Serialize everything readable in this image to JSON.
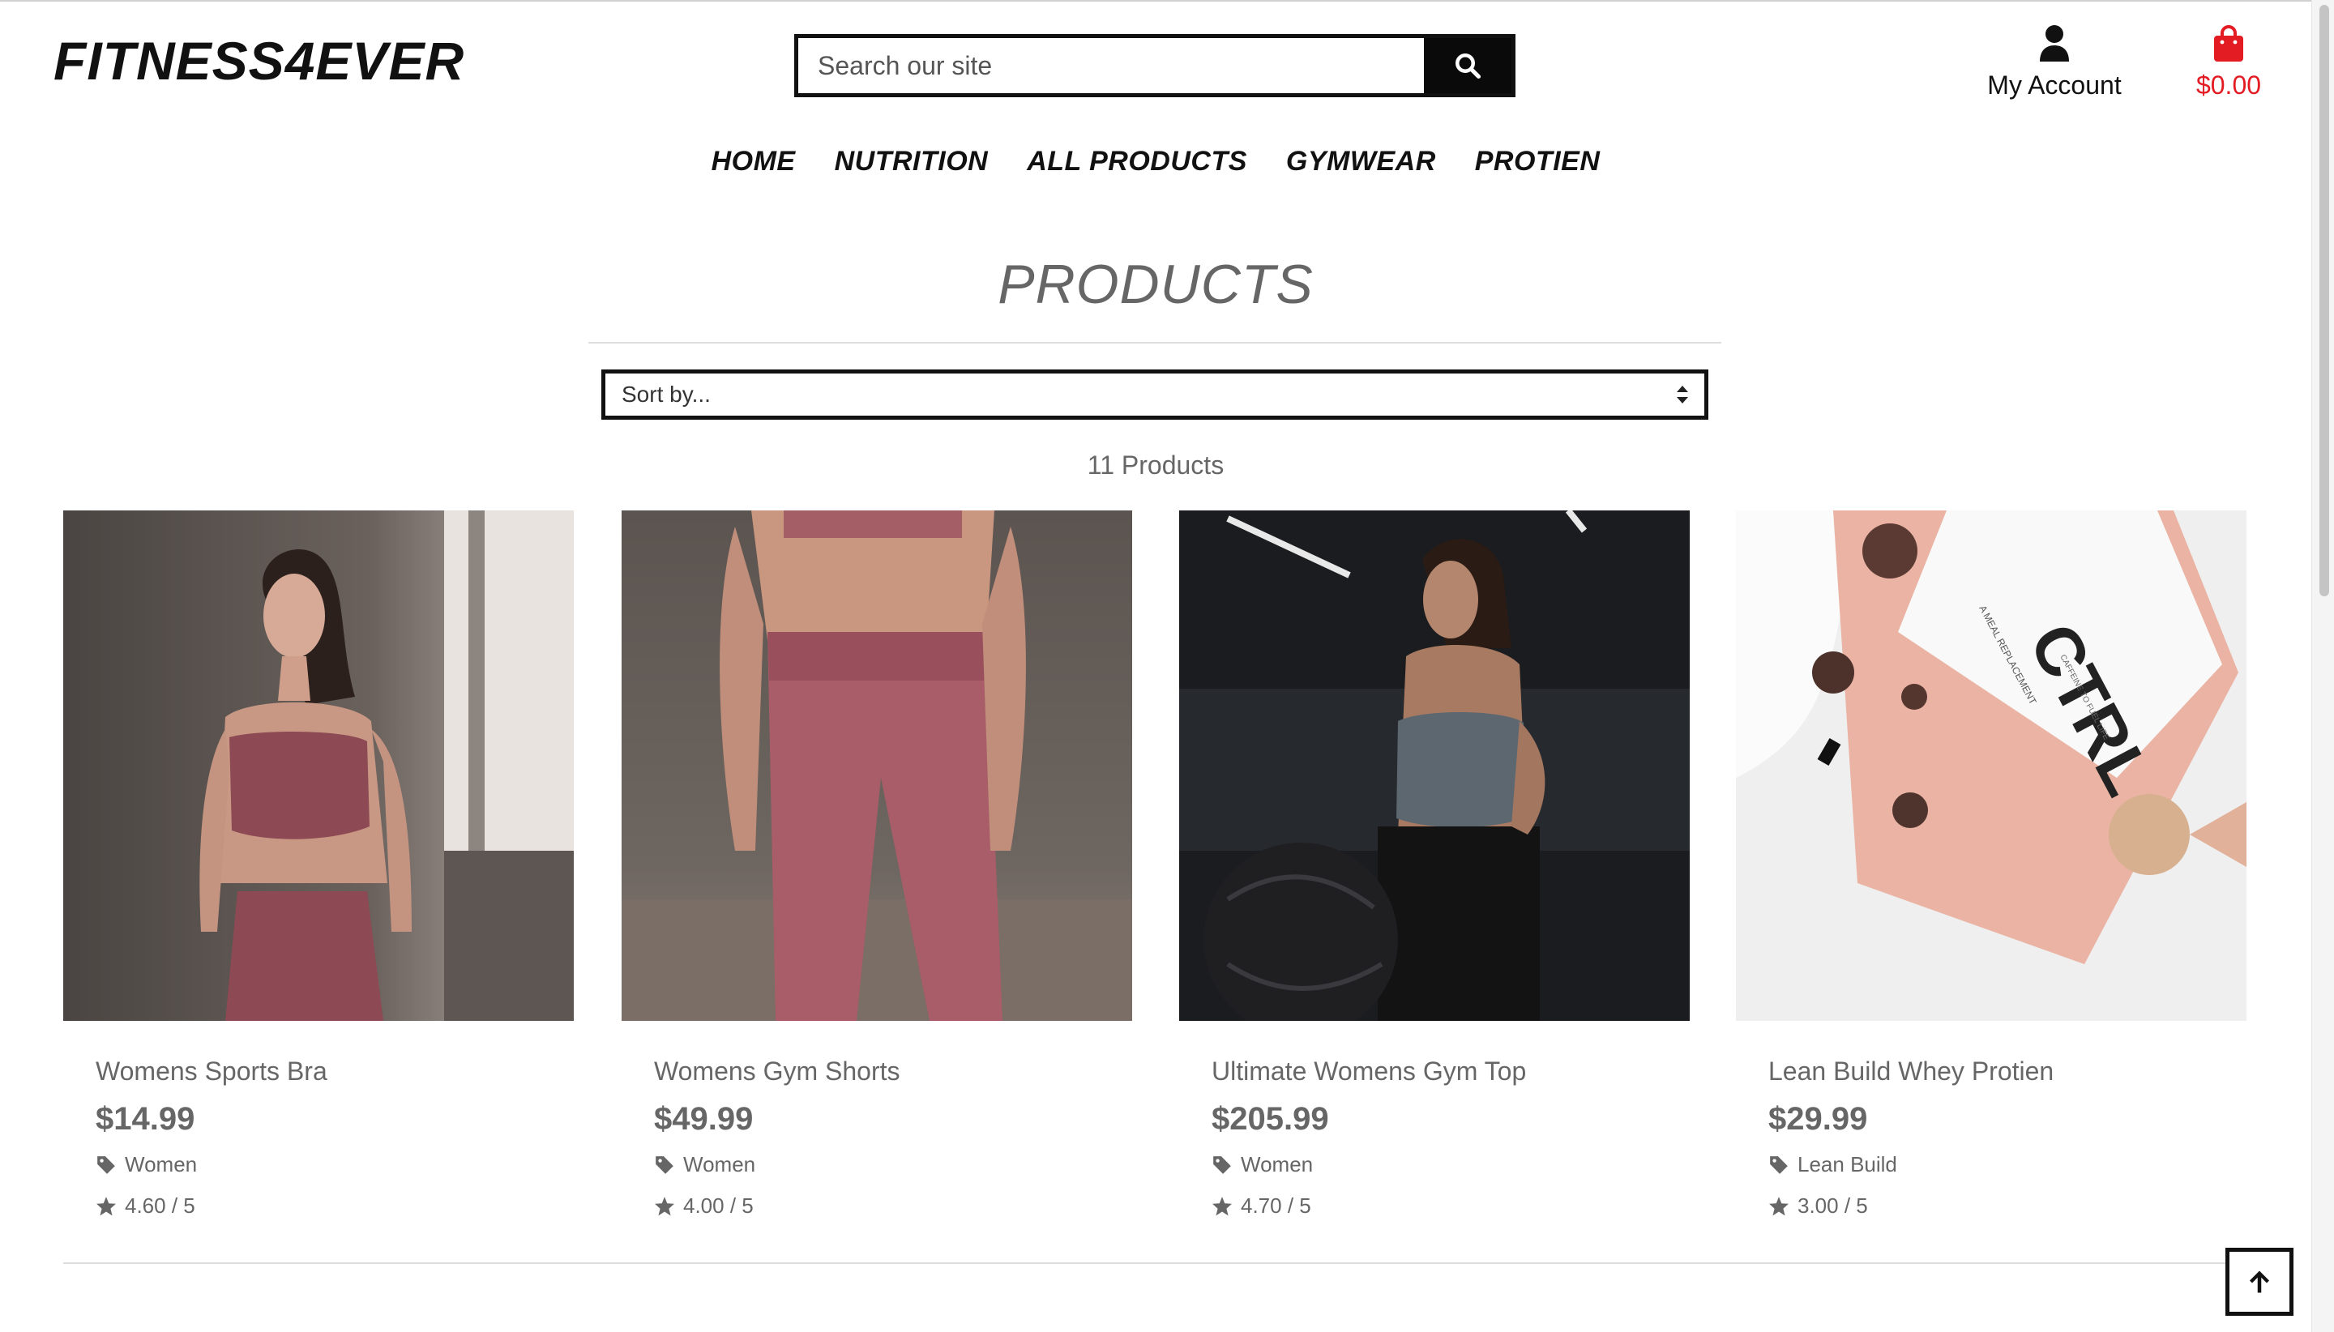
{
  "header": {
    "logo": "FITNESS4EVER",
    "search_placeholder": "Search our site",
    "account_label": "My Account",
    "cart_total": "$0.00",
    "cart_color": "#e31b23"
  },
  "nav": {
    "items": [
      {
        "label": "HOME"
      },
      {
        "label": "NUTRITION"
      },
      {
        "label": "ALL PRODUCTS"
      },
      {
        "label": "GYMWEAR"
      },
      {
        "label": "PROTIEN"
      }
    ]
  },
  "main": {
    "title": "PRODUCTS",
    "sort_value": "Sort by...",
    "product_count": "11 Products",
    "products": [
      {
        "name": "Womens Sports Bra",
        "price": "$14.99",
        "category": "Women",
        "rating": "4.60 / 5"
      },
      {
        "name": "Womens Gym Shorts",
        "price": "$49.99",
        "category": "Women",
        "rating": "4.00 / 5"
      },
      {
        "name": "Ultimate Womens Gym Top",
        "price": "$205.99",
        "category": "Women",
        "rating": "4.70 / 5"
      },
      {
        "name": "Lean Build Whey Protien",
        "price": "$29.99",
        "category": "Lean Build",
        "rating": "3.00 / 5"
      }
    ],
    "package_text": {
      "brand": "CTRL",
      "sub": "A MEAL REPLACEMENT",
      "tag": "CAFFEINE TO FUEL LIFE"
    }
  },
  "icons": {
    "search": "search-icon",
    "account": "user-icon",
    "cart": "shopping-bag-icon",
    "sort": "sort-arrows-icon",
    "tag": "tag-icon",
    "star": "star-icon",
    "back_to_top": "arrow-up-icon"
  }
}
